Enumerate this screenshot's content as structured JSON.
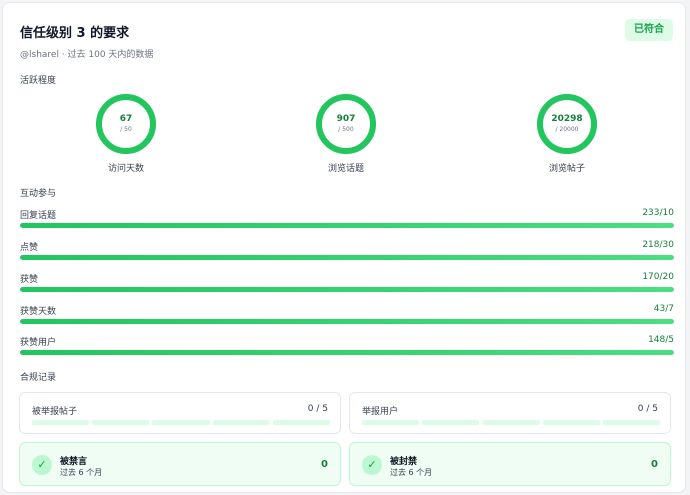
{
  "header": {
    "title": "信任级别 3 的要求",
    "subtitle": "@lsharel · 过去 100 天内的数据",
    "badge": "已符合"
  },
  "sections": {
    "activity": "活跃程度",
    "engagement": "互动参与",
    "compliance": "合规记录"
  },
  "rings": [
    {
      "value": "67",
      "target": "/ 50",
      "label": "访问天数"
    },
    {
      "value": "907",
      "target": "/ 500",
      "label": "浏览话题"
    },
    {
      "value": "20298",
      "target": "/ 20000",
      "label": "浏览帖子"
    }
  ],
  "bars": [
    {
      "label": "回复话题",
      "value": "233/10",
      "progress": 1.0
    },
    {
      "label": "点赞",
      "value": "218/30",
      "progress": 1.0
    },
    {
      "label": "获赞",
      "value": "170/20",
      "progress": 1.0
    },
    {
      "label": "获赞天数",
      "value": "43/7",
      "progress": 1.0
    },
    {
      "label": "获赞用户",
      "value": "148/5",
      "progress": 1.0
    }
  ],
  "records": [
    {
      "label": "被举报帖子",
      "count": "0 / 5"
    },
    {
      "label": "举报用户",
      "count": "0 / 5"
    }
  ],
  "stats": [
    {
      "name": "被禁言",
      "sub": "过去 6 个月",
      "value": "0"
    },
    {
      "name": "被封禁",
      "sub": "过去 6 个月",
      "value": "0"
    }
  ],
  "colors": {
    "accent": "#22c55e",
    "accent_dark": "#15803d",
    "track": "#e5e7eb",
    "badge_bg": "#dcfce7"
  }
}
